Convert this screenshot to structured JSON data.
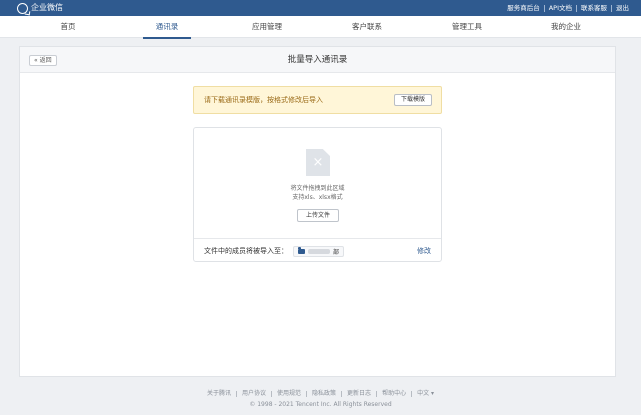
{
  "topbar": {
    "logo_text": "企业微信",
    "links": [
      "服务商后台",
      "API文档",
      "联系客服",
      "退出"
    ]
  },
  "nav": {
    "items": [
      "首页",
      "通讯录",
      "应用管理",
      "客户联系",
      "管理工具",
      "我的企业"
    ],
    "active": "通讯录"
  },
  "panel": {
    "back_label": "返回",
    "title": "批量导入通讯录"
  },
  "notice": {
    "text": "请下载通讯录模版，按格式修改后导入",
    "button": "下载模版"
  },
  "upload": {
    "hint": "将文件拖拽到此区域",
    "formats": "支持xls、xlsx格式",
    "button": "上传文件"
  },
  "destination": {
    "label": "文件中的成员将被导入至：",
    "dept_suffix": "部",
    "modify": "修改"
  },
  "footer": {
    "links": [
      "关于腾讯",
      "用户协议",
      "使用规范",
      "隐私政策",
      "更新日志",
      "帮助中心",
      "中文 ▾"
    ],
    "copyright": "© 1998 - 2021 Tencent Inc. All Rights Reserved"
  },
  "colors": {
    "brand": "#2f5a8f",
    "notice_bg": "#fff6d8",
    "notice_text": "#9a6a17"
  }
}
